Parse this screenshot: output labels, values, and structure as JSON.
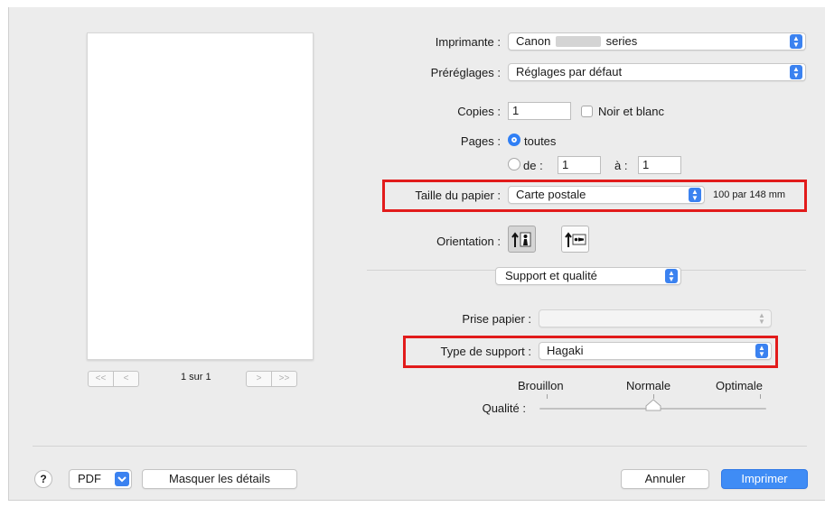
{
  "preview": {
    "page_counter": "1 sur 1",
    "nav_first": "<<",
    "nav_prev": "<",
    "nav_next": ">",
    "nav_last": ">>"
  },
  "printer": {
    "label": "Imprimante :",
    "value_prefix": "Canon",
    "value_suffix": "series"
  },
  "presets": {
    "label": "Préréglages :",
    "value": "Réglages par défaut"
  },
  "copies": {
    "label": "Copies :",
    "value": "1",
    "bw_label": "Noir et blanc"
  },
  "pages": {
    "label": "Pages :",
    "all_label": "toutes",
    "from_label": "de :",
    "from_value": "1",
    "to_label": "à :",
    "to_value": "1"
  },
  "paper_size": {
    "label": "Taille du papier :",
    "value": "Carte postale",
    "dimensions": "100 par 148 mm"
  },
  "orientation": {
    "label": "Orientation :",
    "selected": "portrait"
  },
  "section_menu": {
    "value": "Support et qualité"
  },
  "paper_source": {
    "label": "Prise papier :",
    "value": ""
  },
  "media_type": {
    "label": "Type de support :",
    "value": "Hagaki"
  },
  "quality": {
    "label": "Qualité :",
    "levels": [
      "Brouillon",
      "Normale",
      "Optimale"
    ],
    "selected_index": 1
  },
  "footer": {
    "help": "?",
    "pdf": "PDF",
    "hide_details": "Masquer les détails",
    "cancel": "Annuler",
    "print": "Imprimer"
  },
  "colors": {
    "accent": "#3f8cf5",
    "highlight": "#e21b1b",
    "background": "#ececec"
  },
  "icons": {
    "stepper": "up-down-arrows-icon",
    "chevron": "chevron-down-icon",
    "portrait": "portrait-orientation-icon",
    "landscape": "landscape-orientation-icon"
  }
}
